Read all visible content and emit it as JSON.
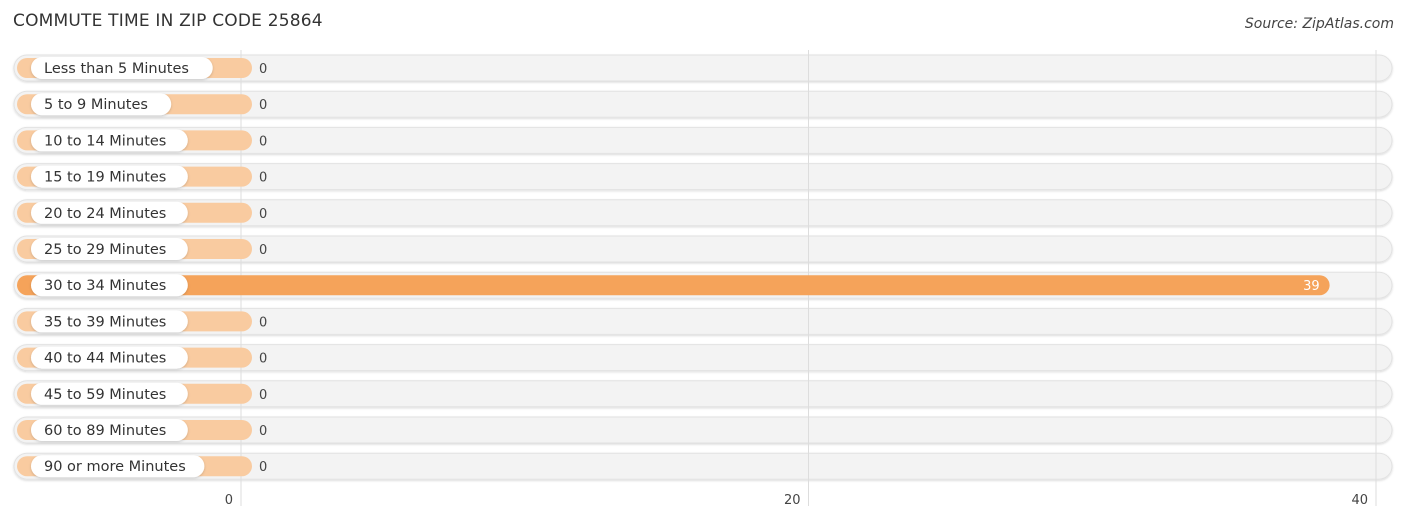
{
  "header": {
    "title": "COMMUTE TIME IN ZIP CODE 25864",
    "source": "Source: ZipAtlas.com"
  },
  "colors": {
    "bar_highlight": "#f5a35a",
    "bar_light": "#f9cba0",
    "track": "#f3f3f3",
    "grid": "#dddddd"
  },
  "chart_data": {
    "type": "bar",
    "orientation": "horizontal",
    "title": "COMMUTE TIME IN ZIP CODE 25864",
    "xlabel": "",
    "ylabel": "",
    "categories": [
      "Less than 5 Minutes",
      "5 to 9 Minutes",
      "10 to 14 Minutes",
      "15 to 19 Minutes",
      "20 to 24 Minutes",
      "25 to 29 Minutes",
      "30 to 34 Minutes",
      "35 to 39 Minutes",
      "40 to 44 Minutes",
      "45 to 59 Minutes",
      "60 to 89 Minutes",
      "90 or more Minutes"
    ],
    "values": [
      0,
      0,
      0,
      0,
      0,
      0,
      39,
      0,
      0,
      0,
      0,
      0
    ],
    "xlim": [
      0,
      40
    ],
    "xticks": [
      0,
      20,
      40
    ],
    "grid": true,
    "legend": "none"
  }
}
